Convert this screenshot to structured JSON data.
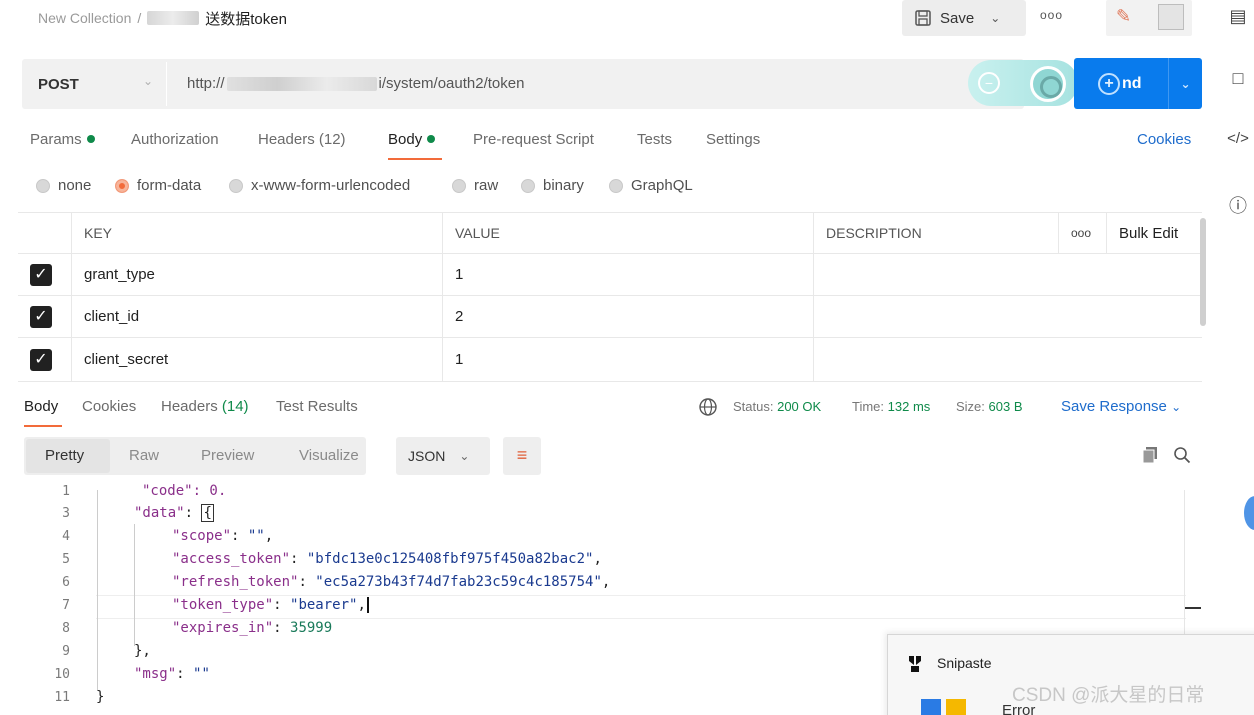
{
  "header": {
    "collection": "New Collection",
    "separator": "/",
    "request_name": "送数据token",
    "save_label": "Save",
    "more": "ooo"
  },
  "request": {
    "method": "POST",
    "url_prefix": "http://",
    "url_suffix": "i/system/oauth2/token",
    "send_label": "nd"
  },
  "tabs": [
    {
      "label": "Params",
      "dot": true
    },
    {
      "label": "Authorization",
      "dot": false
    },
    {
      "label": "Headers (12)",
      "dot": false
    },
    {
      "label": "Body",
      "dot": true
    },
    {
      "label": "Pre-request Script",
      "dot": false
    },
    {
      "label": "Tests",
      "dot": false
    },
    {
      "label": "Settings",
      "dot": false
    }
  ],
  "cookies_label": "Cookies",
  "body_types": [
    "none",
    "form-data",
    "x-www-form-urlencoded",
    "raw",
    "binary",
    "GraphQL"
  ],
  "table": {
    "headers": {
      "key": "KEY",
      "value": "VALUE",
      "description": "DESCRIPTION",
      "more": "ooo",
      "bulk_edit": "Bulk Edit"
    },
    "rows": [
      {
        "key": "grant_type",
        "value": "1",
        "description": ""
      },
      {
        "key": "client_id",
        "value": "2",
        "description": ""
      },
      {
        "key": "client_secret",
        "value": "1",
        "description": ""
      }
    ]
  },
  "response": {
    "tabs": [
      {
        "label": "Body"
      },
      {
        "label": "Cookies"
      },
      {
        "label": "Headers",
        "count": "(14)"
      },
      {
        "label": "Test Results"
      }
    ],
    "status_label": "Status:",
    "status_value": "200 OK",
    "time_label": "Time:",
    "time_value": "132 ms",
    "size_label": "Size:",
    "size_value": "603 B",
    "save_response": "Save Response",
    "formats": [
      "Pretty",
      "Raw",
      "Preview",
      "Visualize"
    ],
    "language": "JSON"
  },
  "code": {
    "line_numbers": [
      "1",
      "3",
      "4",
      "5",
      "6",
      "7",
      "8",
      "9",
      "10",
      "11"
    ],
    "partial_first": "\"code\": 0,",
    "data_key": "\"data\"",
    "scope_key": "\"scope\"",
    "scope_val": "\"\"",
    "access_key": "\"access_token\"",
    "access_val": "\"bfdc13e0c125408fbf975f450a82bac2\"",
    "refresh_key": "\"refresh_token\"",
    "refresh_val": "\"ec5a273b43f74d7fab23c59c4c185754\"",
    "type_key": "\"token_type\"",
    "type_val": "\"bearer\"",
    "expires_key": "\"expires_in\"",
    "expires_val": "35999",
    "close_data": "},",
    "msg_key": "\"msg\"",
    "msg_val": "\"\"",
    "close_root": "}"
  },
  "popup": {
    "title": "Snipaste",
    "error": "Error"
  },
  "watermark": "CSDN @派大星的日常"
}
